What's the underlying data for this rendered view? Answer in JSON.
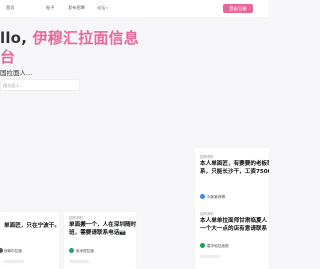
{
  "nav": {
    "items": [
      {
        "label": "首页"
      },
      {
        "label": "帖子"
      },
      {
        "label": "发布招聘"
      },
      {
        "label": "论坛"
      }
    ],
    "cta_label": "登录/注册"
  },
  "hero": {
    "greeting": "llo,",
    "brand_part1": "伊穆汇拉面信息",
    "brand_part2": "台",
    "subtitle": "国拉面人...",
    "search_placeholder": "搜拉面人..."
  },
  "cards": [
    {
      "tag": "招聘求职",
      "title_lines": [
        "本人单面匠，有要要的老板联",
        "系，只能长沙干，工资7500"
      ],
      "author": "刘某某师傅"
    },
    {
      "tag": "",
      "title_lines": [
        "单面匠，只在宁波干。联系",
        ""
      ],
      "author": "伊穆尔拉面"
    },
    {
      "tag": "招聘求职",
      "title_lines": [
        "单面搬一个，人在深圳随时上",
        "班，需要请联系电话📷"
      ],
      "author": "哈米提拉面"
    },
    {
      "tag": "招聘求职",
      "title_lines": [
        "本人单单拉面师甘肃临夏人",
        "一个大一点的店有意请联系"
      ],
      "author": "嘉宇哈拉面馆"
    }
  ],
  "colors": {
    "accent": "#e9689b",
    "avatar1": "#3b82f6",
    "avatar2": "#4b5563",
    "avatar3": "#22a06b",
    "avatar4": "#16a34a"
  }
}
